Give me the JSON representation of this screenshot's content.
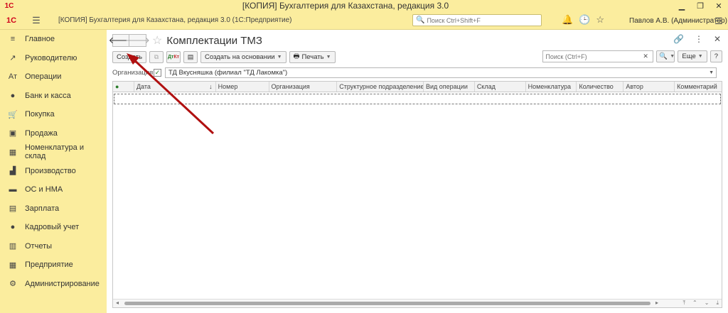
{
  "window": {
    "logo": "1С",
    "title": "[КОПИЯ] Бухгалтерия для Казахстана, редакция 3.0",
    "minimize": "▁",
    "restore": "❐",
    "close": "✕"
  },
  "appbar": {
    "logo": "1С",
    "title": "[КОПИЯ] Бухгалтерия для Казахстана, редакция 3.0  (1С:Предприятие)",
    "search_placeholder": "Поиск Ctrl+Shift+F",
    "user": "Павлов А.В. (Администратор)",
    "icons": [
      "bell-icon",
      "history-icon",
      "star-icon"
    ]
  },
  "sidebar": {
    "items": [
      {
        "label": "Главное",
        "icon": "≡"
      },
      {
        "label": "Руководителю",
        "icon": "↗"
      },
      {
        "label": "Операции",
        "icon": "Ат"
      },
      {
        "label": "Банк и касса",
        "icon": "●"
      },
      {
        "label": "Покупка",
        "icon": "🛒"
      },
      {
        "label": "Продажа",
        "icon": "▣"
      },
      {
        "label": "Номенклатура и склад",
        "icon": "▦"
      },
      {
        "label": "Производство",
        "icon": "▟"
      },
      {
        "label": "ОС и НМА",
        "icon": "▬"
      },
      {
        "label": "Зарплата",
        "icon": "▤"
      },
      {
        "label": "Кадровый учет",
        "icon": "●"
      },
      {
        "label": "Отчеты",
        "icon": "▥"
      },
      {
        "label": "Предприятие",
        "icon": "▦"
      },
      {
        "label": "Администрирование",
        "icon": "⚙"
      }
    ]
  },
  "page": {
    "title": "Комплектации ТМЗ",
    "toolbar": {
      "create": "Создать",
      "create_based_on": "Создать на основании",
      "print": "Печать",
      "search_placeholder": "Поиск (Ctrl+F)",
      "more": "Еще",
      "help": "?"
    },
    "org_label": "Организация:",
    "org_value": "ТД Вкусняшка (филиал \"ТД Лакомка\")",
    "columns": [
      "",
      "Дата",
      "Номер",
      "Организация",
      "Структурное подразделение",
      "Вид операции",
      "Склад",
      "Номенклатура",
      "Количество",
      "Автор",
      "Комментарий"
    ]
  },
  "colors": {
    "accent": "#fbed9e",
    "annotation_arrow": "#b01010"
  }
}
